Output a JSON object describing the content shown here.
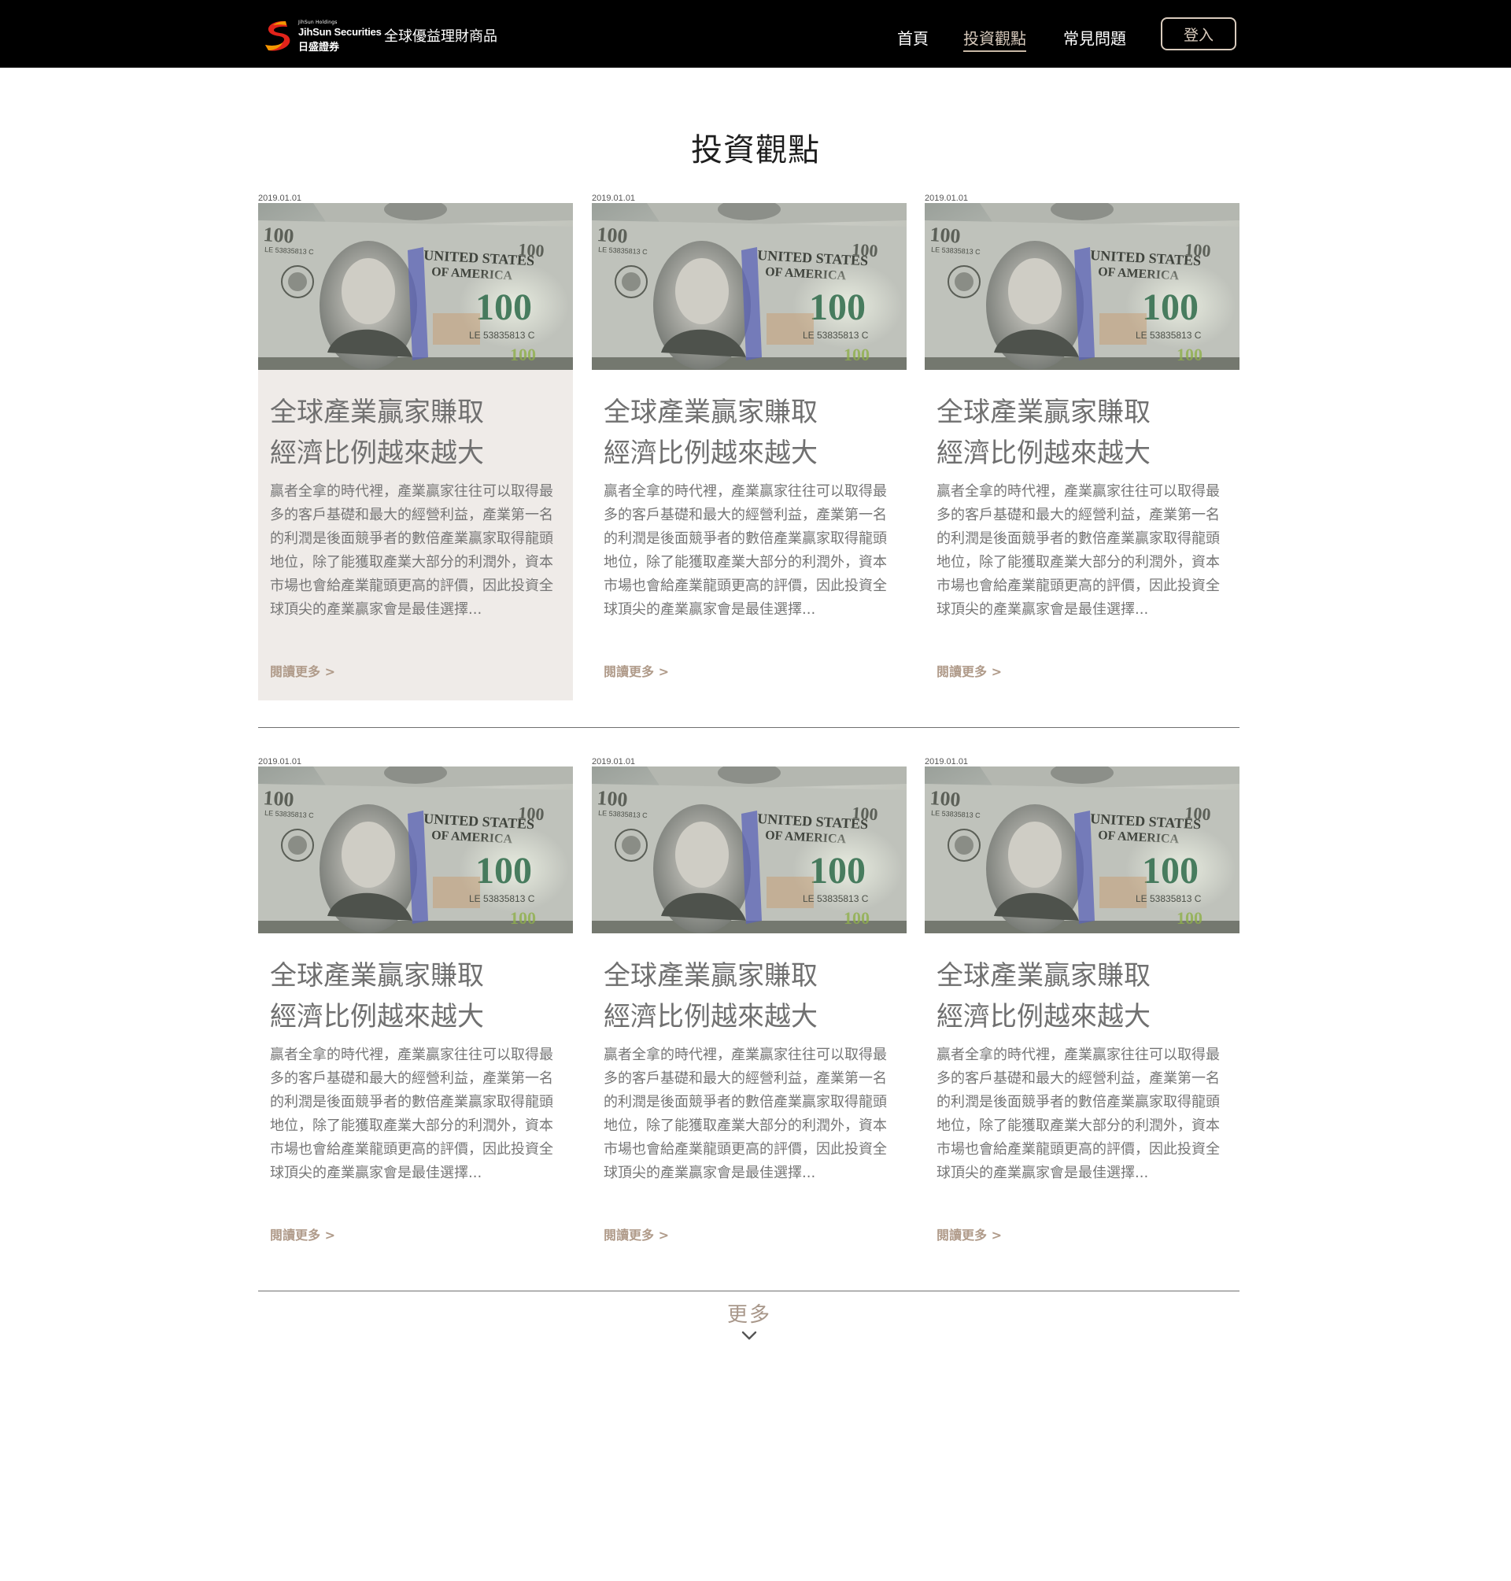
{
  "header": {
    "logo": {
      "small_text": "JihSun Holdings",
      "en_text": "JihSun Securities",
      "zh_text": "日盛證券"
    },
    "site_name": "全球優益理財商品",
    "nav": [
      {
        "label": "首頁"
      },
      {
        "label": "投資觀點"
      },
      {
        "label": "常見問題"
      }
    ],
    "active_nav": "投資觀點",
    "login_label": "登入"
  },
  "page": {
    "title": "投資觀點"
  },
  "articles": [
    {
      "date": "2019.01.01",
      "image": "hundred-dollar-bill-photo",
      "title_line1": "全球產業贏家賺取",
      "title_line2": "經濟比例越來越大",
      "description": "贏者全拿的時代裡，產業贏家往往可以取得最多的客戶基礎和最大的經營利益，產業第一名的利潤是後面競爭者的數倍產業贏家取得龍頭地位，除了能獲取產業大部分的利潤外，資本市場也會給產業龍頭更高的評價，因此投資全球頂尖的產業贏家會是最佳選擇...",
      "read_more": "閱讀更多 >"
    },
    {
      "date": "2019.01.01",
      "image": "hundred-dollar-bill-photo",
      "title_line1": "全球產業贏家賺取",
      "title_line2": "經濟比例越來越大",
      "description": "贏者全拿的時代裡，產業贏家往往可以取得最多的客戶基礎和最大的經營利益，產業第一名的利潤是後面競爭者的數倍產業贏家取得龍頭地位，除了能獲取產業大部分的利潤外，資本市場也會給產業龍頭更高的評價，因此投資全球頂尖的產業贏家會是最佳選擇...",
      "read_more": "閱讀更多 >"
    },
    {
      "date": "2019.01.01",
      "image": "hundred-dollar-bill-photo",
      "title_line1": "全球產業贏家賺取",
      "title_line2": "經濟比例越來越大",
      "description": "贏者全拿的時代裡，產業贏家往往可以取得最多的客戶基礎和最大的經營利益，產業第一名的利潤是後面競爭者的數倍產業贏家取得龍頭地位，除了能獲取產業大部分的利潤外，資本市場也會給產業龍頭更高的評價，因此投資全球頂尖的產業贏家會是最佳選擇...",
      "read_more": "閱讀更多 >"
    },
    {
      "date": "2019.01.01",
      "image": "hundred-dollar-bill-photo",
      "title_line1": "全球產業贏家賺取",
      "title_line2": "經濟比例越來越大",
      "description": "贏者全拿的時代裡，產業贏家往往可以取得最多的客戶基礎和最大的經營利益，產業第一名的利潤是後面競爭者的數倍產業贏家取得龍頭地位，除了能獲取產業大部分的利潤外，資本市場也會給產業龍頭更高的評價，因此投資全球頂尖的產業贏家會是最佳選擇...",
      "read_more": "閱讀更多 >"
    },
    {
      "date": "2019.01.01",
      "image": "hundred-dollar-bill-photo",
      "title_line1": "全球產業贏家賺取",
      "title_line2": "經濟比例越來越大",
      "description": "贏者全拿的時代裡，產業贏家往往可以取得最多的客戶基礎和最大的經營利益，產業第一名的利潤是後面競爭者的數倍產業贏家取得龍頭地位，除了能獲取產業大部分的利潤外，資本市場也會給產業龍頭更高的評價，因此投資全球頂尖的產業贏家會是最佳選擇...",
      "read_more": "閱讀更多 >"
    },
    {
      "date": "2019.01.01",
      "image": "hundred-dollar-bill-photo",
      "title_line1": "全球產業贏家賺取",
      "title_line2": "經濟比例越來越大",
      "description": "贏者全拿的時代裡，產業贏家往往可以取得最多的客戶基礎和最大的經營利益，產業第一名的利潤是後面競爭者的數倍產業贏家取得龍頭地位，除了能獲取產業大部分的利潤外，資本市場也會給產業龍頭更高的評價，因此投資全球頂尖的產業贏家會是最佳選擇...",
      "read_more": "閱讀更多 >"
    }
  ],
  "hovered_article_index": 0,
  "load_more": {
    "label": "更多",
    "icon": "chevron-down-icon"
  },
  "colors": {
    "header_bg": "#000000",
    "accent": "#d9cbbd",
    "read_more": "#b09b8a",
    "card_hover_bg": "#efebe8",
    "load_more": "#a8978a"
  }
}
